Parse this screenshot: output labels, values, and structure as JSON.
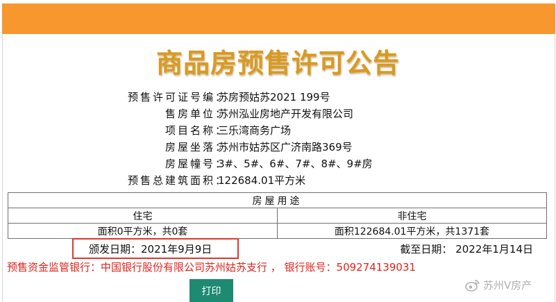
{
  "notice": {
    "title": "商品房预售许可公告"
  },
  "info": [
    {
      "label": "预售许可证号编",
      "value": "苏房预姑苏2021 199号"
    },
    {
      "label": "售房单位",
      "value": "苏州泓业房地产开发有限公司"
    },
    {
      "label": "项目名称",
      "value": "三乐湾商务广场"
    },
    {
      "label": "房屋坐落",
      "value": "苏州市姑苏区广济南路369号"
    },
    {
      "label": "房屋幢号",
      "value": "3#、5#、6#、7#、8#、9#房"
    },
    {
      "label": "预售总建筑面积",
      "value": "122684.01平方米"
    }
  ],
  "separator": "：",
  "usage": {
    "header": "房屋用途",
    "col1": "住宅",
    "col2": "非住宅",
    "val1": "面积0平方米，共0套",
    "val2": "面积122684.01平方米，共1371套"
  },
  "issue_date": "颁发日期：2021年9月9日",
  "expire_date": "截至日期：  2022年1月14日",
  "bank": "预售资金监管银行：中国银行股份有限公司苏州姑苏支行  ，  银行账号：509274139031",
  "print_label": "打印",
  "watermark": "苏州V房产",
  "colors": {
    "top_bar": "#f8972e",
    "title": "#d99a22",
    "highlight_box": "#e0362f",
    "bank_text": "#e0231c",
    "print_button": "#1e8a72"
  }
}
